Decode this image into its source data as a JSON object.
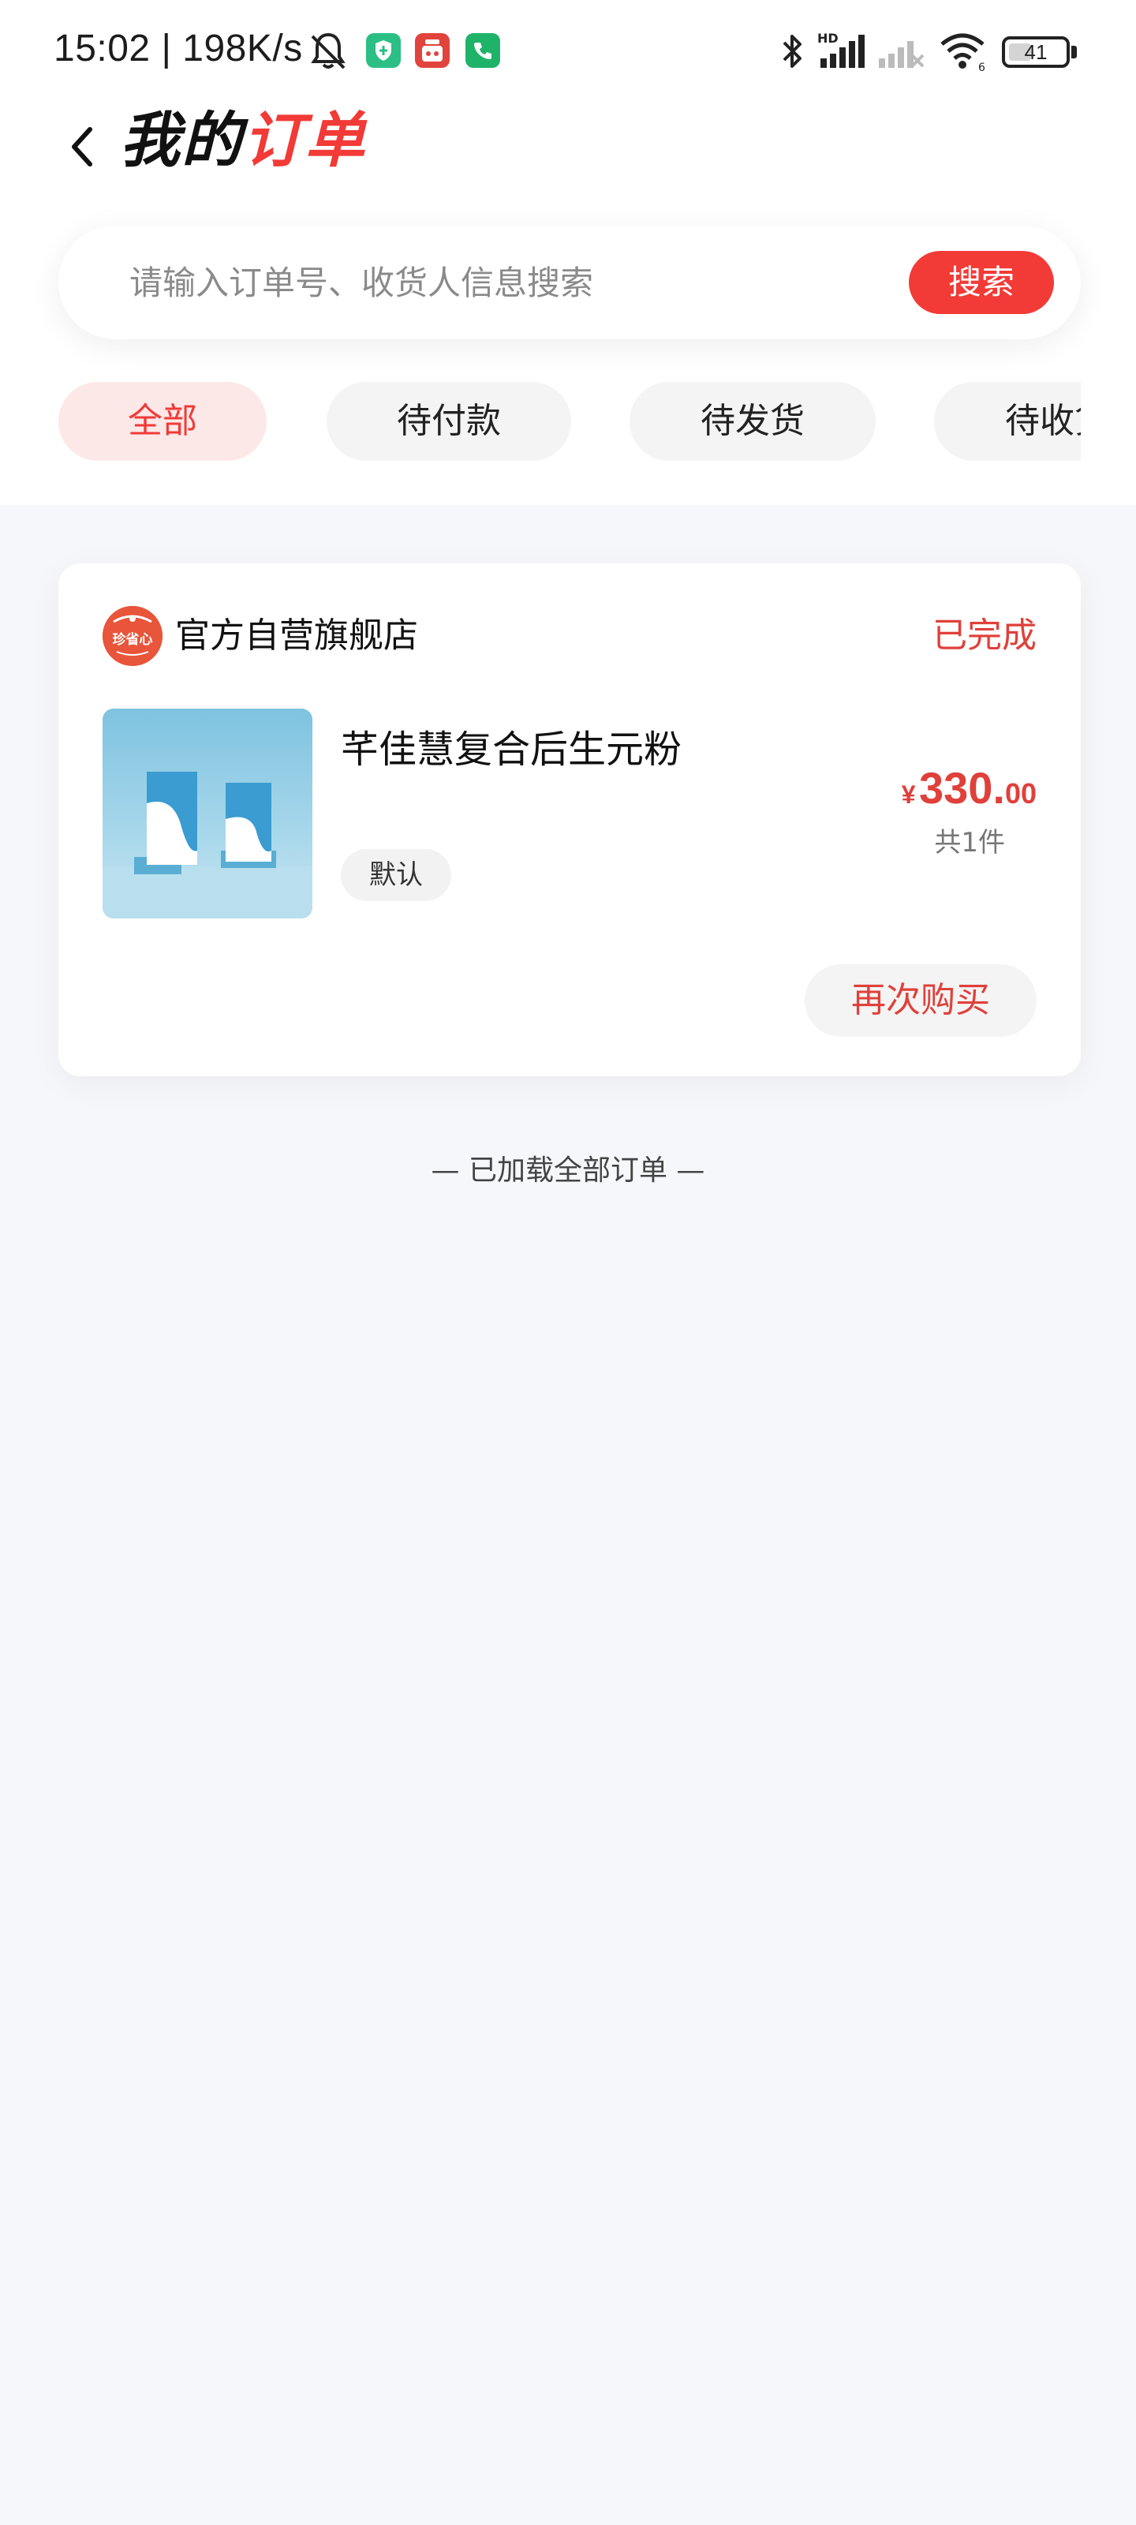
{
  "status_bar": {
    "time_speed": "15:02 | 198K/s",
    "battery_level": "41",
    "battery_fraction": 0.41,
    "icons": [
      "bell-off-icon",
      "shield-app-icon",
      "shop-app-icon",
      "phone-app-icon",
      "bluetooth-icon",
      "hd-signal-icon",
      "no-signal-icon",
      "wifi-icon",
      "battery-icon"
    ]
  },
  "header": {
    "back_icon": "chevron-left-icon",
    "title_part1": "我的",
    "title_part2": "订单"
  },
  "search": {
    "placeholder": "请输入订单号、收货人信息搜索",
    "value": "",
    "button_label": "搜索"
  },
  "tabs": [
    {
      "label": "全部",
      "active": true
    },
    {
      "label": "待付款",
      "active": false
    },
    {
      "label": "待发货",
      "active": false
    },
    {
      "label": "待收货",
      "active": false
    }
  ],
  "orders": [
    {
      "shop_logo_text": "珍省心",
      "shop_name": "官方自营旗舰店",
      "status": "已完成",
      "product_name": "芊佳慧复合后生元粉",
      "spec": "默认",
      "price_symbol": "¥",
      "price_integer": "330.",
      "price_decimal": "00",
      "quantity_text": "共1件",
      "rebuy_label": "再次购买"
    }
  ],
  "footer_note": "— 已加载全部订单 —",
  "colors": {
    "accent": "#f23a36",
    "tab_active_bg": "#fde8e8",
    "page_bg": "#f6f7fb"
  }
}
